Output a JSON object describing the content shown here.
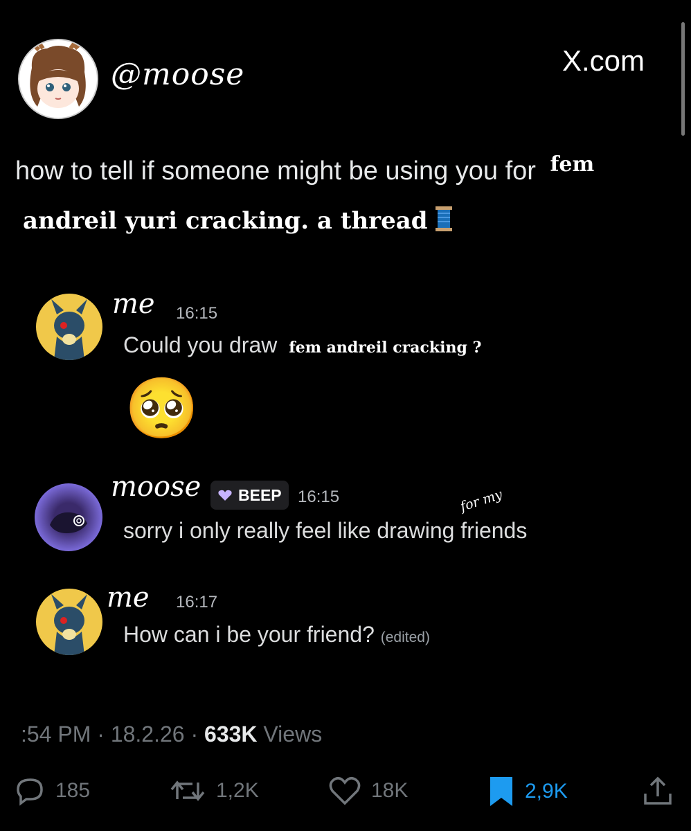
{
  "post": {
    "handle": "@moose",
    "brand": "X.com",
    "text_prefix": "how to tell if someone might be using you for",
    "text_bold_1": "fem",
    "text_line2": "andreil yuri cracking. a thread"
  },
  "messages": [
    {
      "name": "me",
      "time": "16:15",
      "text": "Could you draw",
      "text_bold": "fem andreil cracking ?",
      "emoji": "🥺"
    },
    {
      "name": "moose",
      "badge": "BEEP",
      "time": "16:15",
      "text": "sorry i only really feel like drawing friends",
      "note": "for my"
    },
    {
      "name": "me",
      "time": "16:17",
      "text": "How can i be your friend?",
      "edited": "(edited)"
    }
  ],
  "meta": {
    "time": ":54 PM",
    "date": "18.2.26",
    "views_count": "633K",
    "views_label": "Views"
  },
  "actions": {
    "replies": "185",
    "reposts": "1,2K",
    "likes": "18K",
    "bookmarks": "2,9K"
  },
  "colors": {
    "accent": "#1d9bf0",
    "muted": "#71767b",
    "background": "#000000"
  }
}
